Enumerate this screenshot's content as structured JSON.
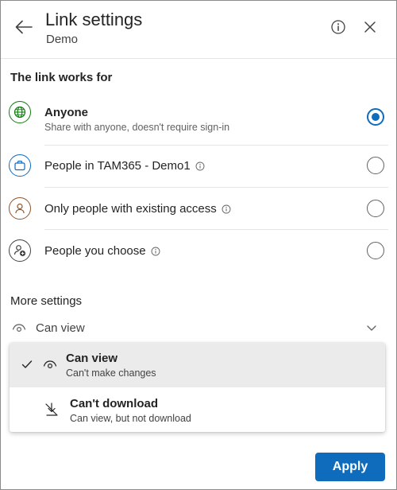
{
  "header": {
    "title": "Link settings",
    "subtitle": "Demo",
    "back_icon": "arrow-left-icon",
    "info_icon": "info-icon",
    "close_icon": "close-icon"
  },
  "link_works_for": {
    "heading": "The link works for",
    "options": [
      {
        "label": "Anyone",
        "description": "Share with anyone, doesn't require sign-in",
        "icon": "globe-icon",
        "selected": true,
        "has_info": false
      },
      {
        "label": "People in TAM365 - Demo1",
        "description": "",
        "icon": "briefcase-icon",
        "selected": false,
        "has_info": true
      },
      {
        "label": "Only people with existing access",
        "description": "",
        "icon": "person-icon",
        "selected": false,
        "has_info": true
      },
      {
        "label": "People you choose",
        "description": "",
        "icon": "person-add-icon",
        "selected": false,
        "has_info": true
      }
    ]
  },
  "more_settings": {
    "heading": "More settings",
    "permission_dropdown": {
      "value": "Can view",
      "icon": "eye-icon"
    },
    "menu": [
      {
        "title": "Can view",
        "description": "Can't make changes",
        "icon": "eye-icon",
        "selected": true
      },
      {
        "title": "Can't download",
        "description": "Can view, but not download",
        "icon": "no-download-icon",
        "selected": false
      }
    ]
  },
  "footer": {
    "apply_label": "Apply"
  },
  "colors": {
    "accent": "#0f6cbd",
    "globe_green": "#107c10",
    "briefcase_blue": "#0f6cbd",
    "person_brown": "#8e562e"
  }
}
